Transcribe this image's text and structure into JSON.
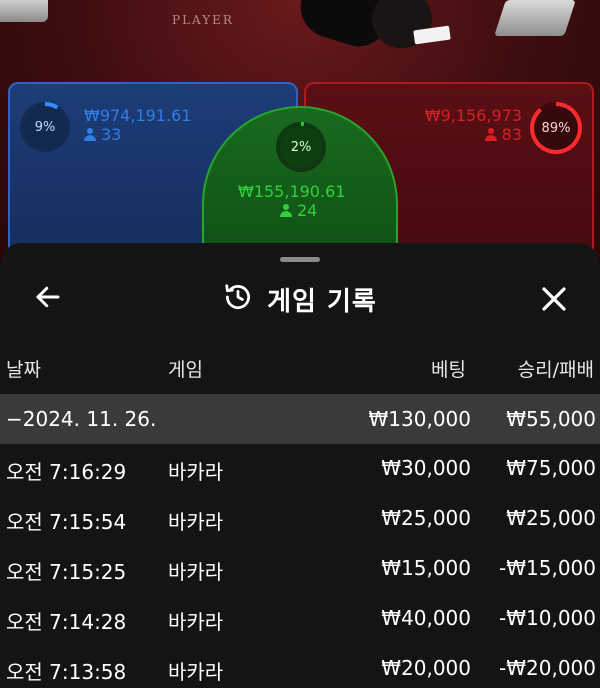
{
  "table": {
    "felt_label": "PLAYER",
    "player": {
      "percent": "9%",
      "amount": "₩974,191.61",
      "count": "33",
      "color": "#2f7fe6"
    },
    "banker": {
      "percent": "89%",
      "amount": "₩9,156,973",
      "count": "83",
      "color": "#d81e26"
    },
    "tie": {
      "percent": "2%",
      "amount": "₩155,190.61",
      "count": "24",
      "color": "#2fd13c"
    }
  },
  "sheet": {
    "title": "게임 기록",
    "icons": {
      "back": "arrow-left-icon",
      "history": "history-icon",
      "close": "close-icon"
    },
    "columns": {
      "date": "날짜",
      "game": "게임",
      "bet": "베팅",
      "result": "승리/패배"
    },
    "date_group": {
      "date": "−2024. 11. 26.",
      "bet_total": "₩130,000",
      "result_total": "₩55,000"
    },
    "rows": [
      {
        "time": "오전 7:16:29",
        "game": "바카라",
        "bet": "₩30,000",
        "result": "₩75,000"
      },
      {
        "time": "오전 7:15:54",
        "game": "바카라",
        "bet": "₩25,000",
        "result": "₩25,000"
      },
      {
        "time": "오전 7:15:25",
        "game": "바카라",
        "bet": "₩15,000",
        "result": "-₩15,000"
      },
      {
        "time": "오전 7:14:28",
        "game": "바카라",
        "bet": "₩40,000",
        "result": "-₩10,000"
      },
      {
        "time": "오전 7:13:58",
        "game": "바카라",
        "bet": "₩20,000",
        "result": "-₩20,000"
      }
    ]
  }
}
